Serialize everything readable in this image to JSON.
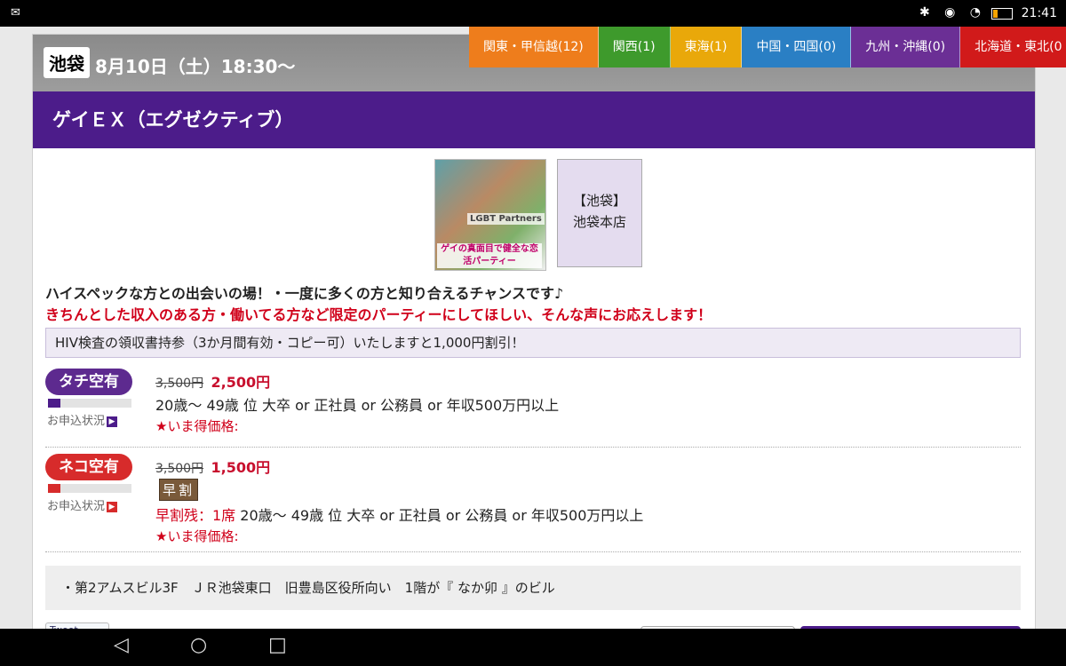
{
  "status_bar": {
    "time": "21:41",
    "icons": "✱ ◉ ◔"
  },
  "event": {
    "area_badge": "池袋",
    "date": "8月10日（土）18:30〜",
    "title": "ゲイＥＸ（エグゼクティブ）"
  },
  "region_tabs": [
    {
      "label": "関東・甲信越(12)",
      "color": "#ee7d1c"
    },
    {
      "label": "関西(1)",
      "color": "#3e9a2c"
    },
    {
      "label": "東海(1)",
      "color": "#e9a80a"
    },
    {
      "label": "中国・四国(0)",
      "color": "#2a7fc4"
    },
    {
      "label": "九州・沖縄(0)",
      "color": "#6b2f95"
    },
    {
      "label": "北海道・東北(0",
      "color": "#d11a1a"
    }
  ],
  "hero": {
    "image_text": "LGBT Partners",
    "image_caption": "ゲイの真面目で健全な恋活パーティー",
    "shop_name": "【池袋】",
    "shop_branch": "池袋本店"
  },
  "lead_line_1": "ハイスペックな方との出会いの場！・一度に多くの方と知り合えるチャンスです♪",
  "lead_line_2": "きちんとした収入のある方・働いてる方など限定のパーティーにしてほしい、そんな声にお応えします！",
  "notice": "HIV検査の領収書持参（3か月間有効・コピー可）いたしますと1,000円割引！",
  "plans": [
    {
      "status": "タチ空有",
      "apply_label": "お申込状況",
      "apply_level": 0.15,
      "old_price": "3,500円",
      "new_price": "2,500円",
      "condition": "20歳〜 49歳 位 大卒 or 正社員 or 公務員 or 年収500万円以上",
      "deal_label": "★いま得価格:"
    },
    {
      "status": "ネコ空有",
      "apply_label": "お申込状況",
      "apply_level": 0.15,
      "old_price": "3,500円",
      "new_price": "1,500円",
      "early_tag": "早割",
      "remaining": "早割残：1席",
      "condition": " 20歳〜 49歳 位 大卒 or 正社員 or 公務員 or 年収500万円以上",
      "deal_label": "★いま得価格:"
    }
  ],
  "access": "・第2アムスビル3F　ＪＲ池袋東口　旧豊島区役所向い　1階が『 なか卯 』のビル",
  "tweet_label": "Tweet",
  "colors": {
    "primary": "#4c1c8a",
    "accent_red": "#d0001a"
  }
}
